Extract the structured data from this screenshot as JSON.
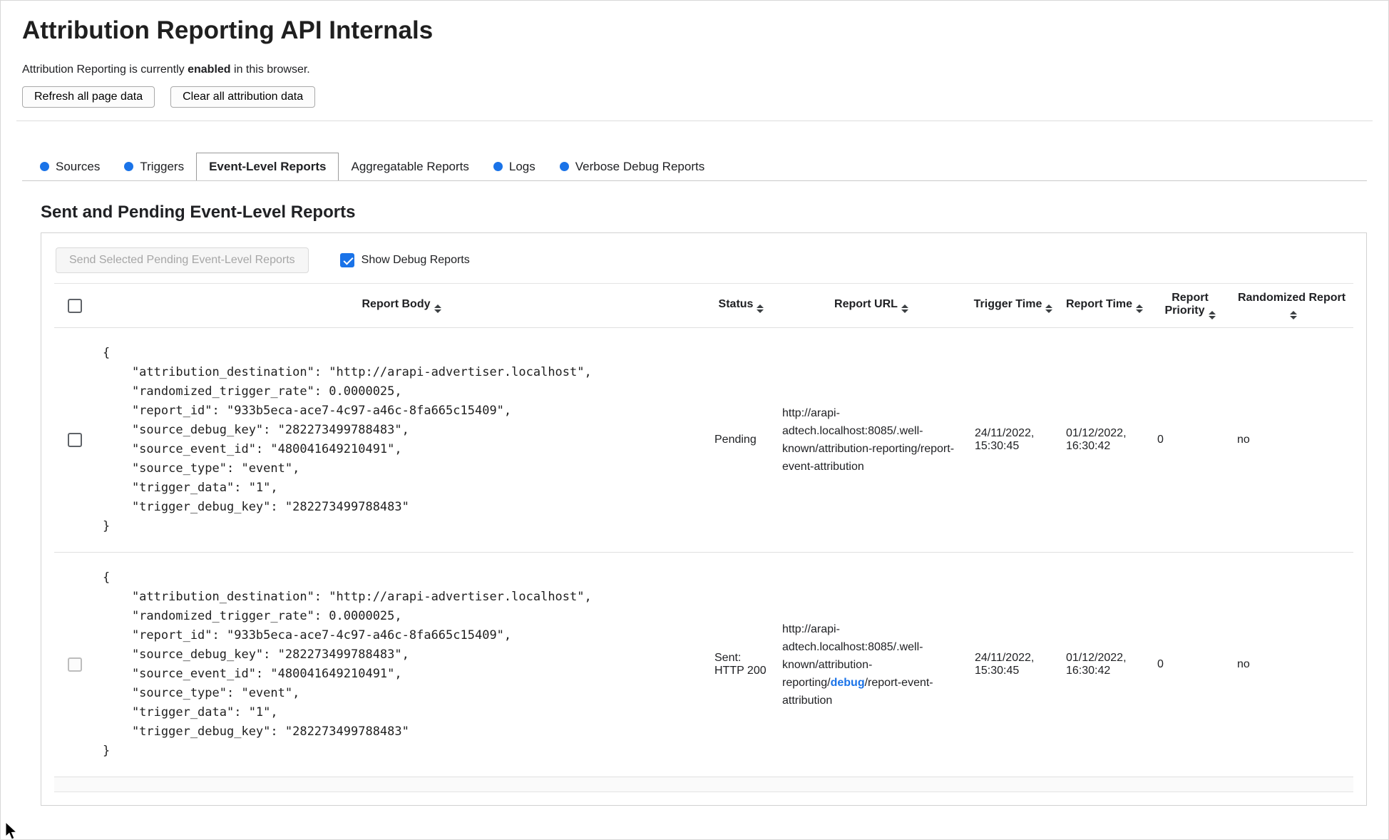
{
  "page": {
    "title": "Attribution Reporting API Internals",
    "status_prefix": "Attribution Reporting is currently ",
    "status_bold": "enabled",
    "status_suffix": " in this browser.",
    "buttons": {
      "refresh": "Refresh all page data",
      "clear": "Clear all attribution data"
    }
  },
  "tabs": [
    {
      "label": "Sources",
      "has_data_dot": true,
      "active": false
    },
    {
      "label": "Triggers",
      "has_data_dot": true,
      "active": false
    },
    {
      "label": "Event-Level Reports",
      "has_data_dot": false,
      "active": true
    },
    {
      "label": "Aggregatable Reports",
      "has_data_dot": false,
      "active": false
    },
    {
      "label": "Logs",
      "has_data_dot": true,
      "active": false
    },
    {
      "label": "Verbose Debug Reports",
      "has_data_dot": true,
      "active": false
    }
  ],
  "section": {
    "heading": "Sent and Pending Event-Level Reports",
    "send_button_label": "Send Selected Pending Event-Level Reports",
    "send_button_disabled": true,
    "show_debug_label": "Show Debug Reports",
    "show_debug_checked": true
  },
  "table": {
    "headers": {
      "report_body": "Report Body",
      "status": "Status",
      "report_url": "Report URL",
      "trigger_time": "Trigger Time",
      "report_time": "Report Time",
      "report_priority": "Report Priority",
      "randomized_report": "Randomized Report"
    },
    "rows": [
      {
        "selected": false,
        "checkbox_disabled": false,
        "report_body": "{\n    \"attribution_destination\": \"http://arapi-advertiser.localhost\",\n    \"randomized_trigger_rate\": 0.0000025,\n    \"report_id\": \"933b5eca-ace7-4c97-a46c-8fa665c15409\",\n    \"source_debug_key\": \"282273499788483\",\n    \"source_event_id\": \"480041649210491\",\n    \"source_type\": \"event\",\n    \"trigger_data\": \"1\",\n    \"trigger_debug_key\": \"282273499788483\"\n}",
        "status": "Pending",
        "report_url_prefix": "http://arapi-adtech.localhost:8085/.well-known/attribution-reporting/",
        "report_url_link": "",
        "report_url_suffix": "report-event-attribution",
        "trigger_time": "24/11/2022, 15:30:45",
        "report_time": "01/12/2022, 16:30:42",
        "report_priority": "0",
        "randomized_report": "no"
      },
      {
        "selected": false,
        "checkbox_disabled": true,
        "report_body": "{\n    \"attribution_destination\": \"http://arapi-advertiser.localhost\",\n    \"randomized_trigger_rate\": 0.0000025,\n    \"report_id\": \"933b5eca-ace7-4c97-a46c-8fa665c15409\",\n    \"source_debug_key\": \"282273499788483\",\n    \"source_event_id\": \"480041649210491\",\n    \"source_type\": \"event\",\n    \"trigger_data\": \"1\",\n    \"trigger_debug_key\": \"282273499788483\"\n}",
        "status": "Sent: HTTP 200",
        "report_url_prefix": "http://arapi-adtech.localhost:8085/.well-known/attribution-reporting/",
        "report_url_link": "debug",
        "report_url_suffix": "/report-event-attribution",
        "trigger_time": "24/11/2022, 15:30:45",
        "report_time": "01/12/2022, 16:30:42",
        "report_priority": "0",
        "randomized_report": "no"
      }
    ]
  },
  "colors": {
    "accent_blue": "#1a73e8",
    "text": "#202124",
    "disabled_text": "#a6a6a6",
    "panel_border": "#d2d2d2",
    "row_border": "#e0e0e0"
  }
}
